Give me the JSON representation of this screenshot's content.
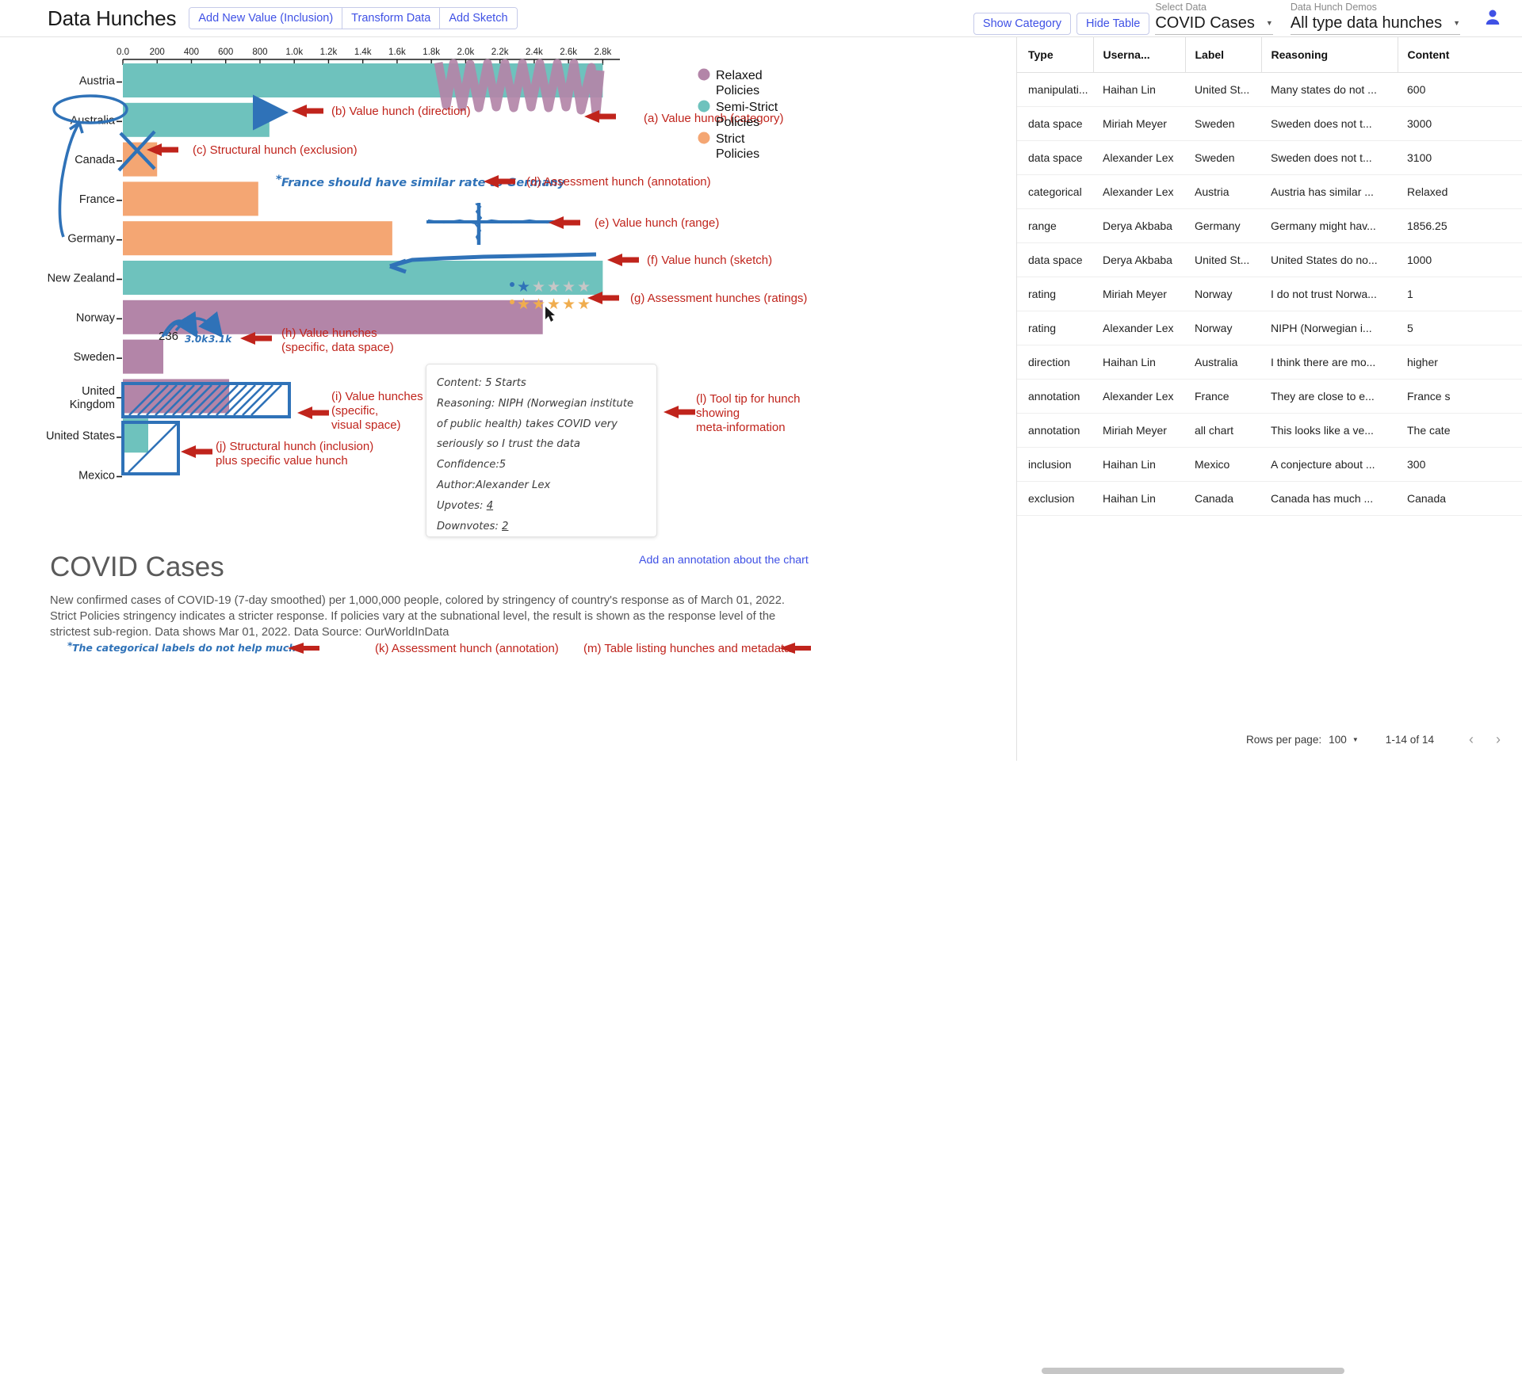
{
  "header": {
    "app_title": "Data Hunches",
    "left_buttons": [
      {
        "label": "Add New Value (Inclusion)",
        "name": "add-new-value-inclusion-button"
      },
      {
        "label": "Transform Data",
        "name": "transform-data-button"
      },
      {
        "label": "Add Sketch",
        "name": "add-sketch-button"
      }
    ],
    "show_category_label": "Show Category",
    "hide_table_label": "Hide Table",
    "select_data": {
      "label": "Select Data",
      "value": "COVID Cases"
    },
    "data_hunch_demos": {
      "label": "Data Hunch Demos",
      "value": "All type data hunches"
    },
    "avatar_name": "account-avatar"
  },
  "chart_data": {
    "type": "bar",
    "orientation": "horizontal",
    "title": "COVID Cases",
    "xlabel": "",
    "ylabel": "",
    "xlim": [
      0,
      2900
    ],
    "grid": false,
    "tick_labels": [
      "0.0",
      "200",
      "400",
      "600",
      "800",
      "1.0k",
      "1.2k",
      "1.4k",
      "1.6k",
      "1.8k",
      "2.0k",
      "2.2k",
      "2.4k",
      "2.6k",
      "2.8k"
    ],
    "tick_values": [
      0,
      200,
      400,
      600,
      800,
      1000,
      1200,
      1400,
      1600,
      1800,
      2000,
      2200,
      2400,
      2600,
      2800
    ],
    "categories": [
      "Austria",
      "Australia",
      "Canada",
      "France",
      "Germany",
      "New Zealand",
      "Norway",
      "Sweden",
      "United Kingdom",
      "United States",
      "Mexico"
    ],
    "values": [
      2800,
      855,
      200,
      790,
      1572,
      2800,
      2450,
      236,
      620,
      350,
      300
    ],
    "colors": [
      "#6ec2bd",
      "#6ec2bd",
      "#f4a673",
      "#f4a673",
      "#f4a673",
      "#6ec2bd",
      "#b385a8",
      "#b385a8",
      "#b385a8",
      "#6ec2bd",
      "#b385a8"
    ],
    "legend": {
      "position": "top-right",
      "entries": [
        {
          "label": "Relaxed Policies",
          "color": "#b385a8"
        },
        {
          "label": "Semi-Strict Policies",
          "color": "#6ec2bd"
        },
        {
          "label": "Strict Policies",
          "color": "#f4a673"
        }
      ]
    },
    "data_hunches": [
      {
        "key": "a",
        "label": "(a) Value hunch (category)",
        "target": "Austria",
        "kind": "category-scribble"
      },
      {
        "key": "b",
        "label": "(b) Value hunch (direction)",
        "target": "Australia",
        "kind": "direction-arrow",
        "direction": "higher"
      },
      {
        "key": "c",
        "label": "(c) Structural hunch (exclusion)",
        "target": "Canada",
        "kind": "exclusion-cross"
      },
      {
        "key": "d",
        "label": "(d) Assessment hunch (annotation)",
        "target": "France",
        "kind": "annotation",
        "text": "France should have similar rate to Germany"
      },
      {
        "key": "e",
        "label": "(e) Value hunch (range)",
        "target": "Germany",
        "kind": "range",
        "value": 1856.25
      },
      {
        "key": "f",
        "label": "(f) Value hunch (sketch)",
        "target": "New Zealand",
        "kind": "sketch-line"
      },
      {
        "key": "g",
        "label": "(g) Assessment hunches (ratings)",
        "target": "Norway",
        "kind": "ratings",
        "ratings": [
          1,
          5
        ],
        "max": 5
      },
      {
        "key": "h",
        "label": "(h) Value hunches\n(specific, data space)",
        "target": "Sweden",
        "kind": "specific-data-space",
        "displayed_value": "236",
        "hunch_values": [
          "3.0k",
          "3.1k"
        ]
      },
      {
        "key": "i",
        "label": "(i) Value hunches\n(specific,\nvisual space)",
        "target": "United States",
        "kind": "specific-visual-space"
      },
      {
        "key": "j",
        "label": "(j) Structural hunch (inclusion)\nplus specific value hunch",
        "target": "Mexico",
        "kind": "inclusion-sketch"
      },
      {
        "key": "k",
        "label": "(k) Assessment hunch (annotation)",
        "target": "all chart",
        "kind": "chart-annotation",
        "text": "The categorical labels do not help much"
      },
      {
        "key": "l",
        "label": "(l) Tool tip for hunch\nshowing\nmeta-information",
        "target": "tooltip",
        "kind": "tooltip-callout"
      },
      {
        "key": "m",
        "label": "(m) Table listing hunches and metadata",
        "target": "table",
        "kind": "table-callout"
      }
    ],
    "annotation_france": "France should have similar rate to Germany",
    "sweden_displayed_value": "236",
    "sweden_hunch_labels": [
      "3.0k",
      "3.1k"
    ],
    "callout_a": "(a) Value hunch (category)",
    "callout_b": "(b) Value hunch (direction)",
    "callout_c": "(c) Structural hunch (exclusion)",
    "callout_d": "(d) Assessment hunch (annotation)",
    "callout_e": "(e) Value hunch (range)",
    "callout_f": "(f) Value hunch (sketch)",
    "callout_g": "(g) Assessment hunches (ratings)",
    "callout_h_l1": "(h) Value hunches",
    "callout_h_l2": "(specific, data space)",
    "callout_i_l1": "(i) Value hunches",
    "callout_i_l2": "(specific,",
    "callout_i_l3": "visual space)",
    "callout_j_l1": "(j) Structural hunch (inclusion)",
    "callout_j_l2": "plus specific value hunch",
    "callout_l_l1": "(l) Tool tip for hunch",
    "callout_l_l2": "showing",
    "callout_l_l3": "meta-information"
  },
  "tooltip": {
    "content_line": "Content: 5 Starts",
    "reasoning_line": "Reasoning: NIPH (Norwegian institute of public health) takes COVID very seriously so I trust the data",
    "confidence_line": "Confidence:5",
    "author_line": "Author:Alexander Lex",
    "upvotes_label": "Upvotes:",
    "upvotes_value": "4",
    "downvotes_label": "Downvotes:",
    "downvotes_value": "2"
  },
  "description": {
    "title": "COVID Cases",
    "body": "New confirmed cases of COVID-19 (7-day smoothed) per 1,000,000 people, colored by stringency of country's response as of March 01, 2022. Strict Policies stringency indicates a stricter response. If policies vary at the subnational level, the result is shown as the response level of the strictest sub-region. Data shows Mar 01, 2022. Data Source: OurWorldInData",
    "add_annotation_link": "Add an annotation about the chart"
  },
  "bottom_notes": {
    "hand_note": "The categorical labels do not help much",
    "callout_k": "(k) Assessment hunch (annotation)",
    "callout_m": "(m) Table listing hunches and metadata"
  },
  "table": {
    "columns": [
      "Type",
      "Userna...",
      "Label",
      "Reasoning",
      "Content"
    ],
    "rows": [
      {
        "type": "manipulati...",
        "username": "Haihan Lin",
        "label": "United St...",
        "reasoning": "Many states do not ...",
        "content": "600"
      },
      {
        "type": "data space",
        "username": "Miriah Meyer",
        "label": "Sweden",
        "reasoning": "Sweden does not t...",
        "content": "3000"
      },
      {
        "type": "data space",
        "username": "Alexander Lex",
        "label": "Sweden",
        "reasoning": "Sweden does not t...",
        "content": "3100"
      },
      {
        "type": "categorical",
        "username": "Alexander Lex",
        "label": "Austria",
        "reasoning": "Austria has similar ...",
        "content": "Relaxed"
      },
      {
        "type": "range",
        "username": "Derya Akbaba",
        "label": "Germany",
        "reasoning": "Germany might hav...",
        "content": "1856.25"
      },
      {
        "type": "data space",
        "username": "Derya Akbaba",
        "label": "United St...",
        "reasoning": "United States do no...",
        "content": "1000"
      },
      {
        "type": "rating",
        "username": "Miriah Meyer",
        "label": "Norway",
        "reasoning": "I do not trust Norwa...",
        "content": "1"
      },
      {
        "type": "rating",
        "username": "Alexander Lex",
        "label": "Norway",
        "reasoning": "NIPH (Norwegian i...",
        "content": "5"
      },
      {
        "type": "direction",
        "username": "Haihan Lin",
        "label": "Australia",
        "reasoning": "I think there are mo...",
        "content": "higher"
      },
      {
        "type": "annotation",
        "username": "Alexander Lex",
        "label": "France",
        "reasoning": "They are close to e...",
        "content": "France s"
      },
      {
        "type": "annotation",
        "username": "Miriah Meyer",
        "label": "all chart",
        "reasoning": "This looks like a ve...",
        "content": "The cate"
      },
      {
        "type": "inclusion",
        "username": "Haihan Lin",
        "label": "Mexico",
        "reasoning": "A conjecture about ...",
        "content": "300"
      },
      {
        "type": "exclusion",
        "username": "Haihan Lin",
        "label": "Canada",
        "reasoning": "Canada has much ...",
        "content": "Canada"
      }
    ],
    "footer": {
      "rows_per_page_label": "Rows per page:",
      "rows_per_page_value": "100",
      "range_label": "1-14 of 14",
      "prev_label": "‹",
      "next_label": "›"
    }
  }
}
